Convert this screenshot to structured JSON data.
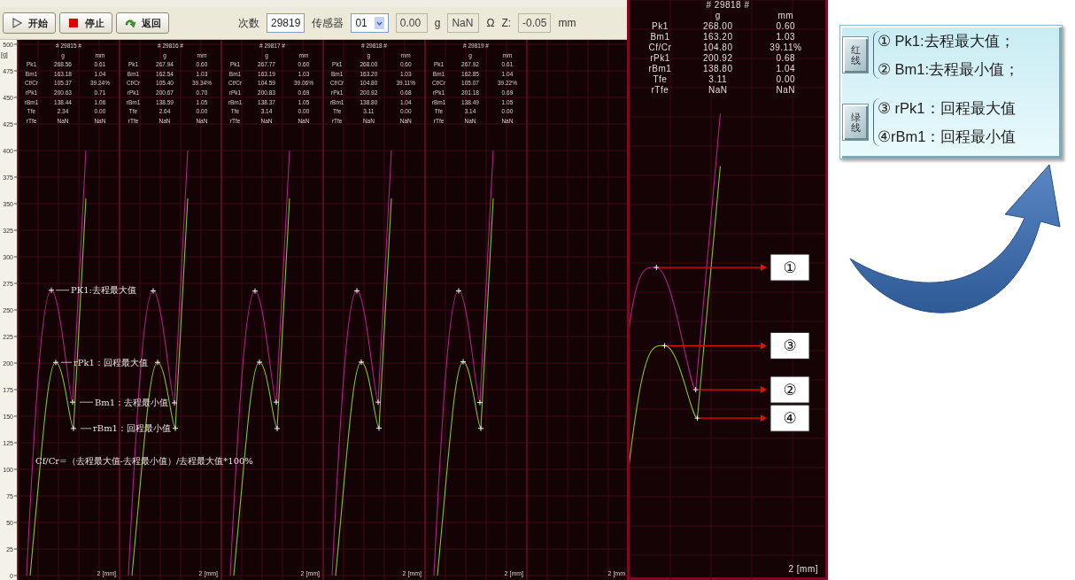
{
  "toolbar": {
    "buttons": [
      {
        "label": "开始",
        "kind": "start"
      },
      {
        "label": "停止",
        "kind": "stop"
      },
      {
        "label": "返回",
        "kind": "return"
      }
    ],
    "fields": [
      {
        "label": "次数",
        "value": "29819",
        "kind": "input",
        "disabled": false
      },
      {
        "label": "传感器",
        "value": "01",
        "kind": "select",
        "disabled": false
      },
      {
        "value": "0.00",
        "unit": "g",
        "kind": "input",
        "disabled": true
      },
      {
        "value": "NaN",
        "unit": "Ω",
        "kind": "input",
        "disabled": true
      },
      {
        "label": "Z:",
        "value": "-0.05",
        "unit": "mm",
        "kind": "input",
        "disabled": true
      }
    ]
  },
  "y_axis": {
    "unit": "[g]",
    "ticks": [
      "500",
      "475",
      "450",
      "425",
      "400",
      "375",
      "350",
      "325",
      "300",
      "275",
      "250",
      "225",
      "200",
      "175",
      "150",
      "125",
      "100",
      "75",
      "50",
      "25",
      "0"
    ]
  },
  "panels": [
    {
      "title": "# 29815 #",
      "columns": [
        "",
        "g",
        "mm"
      ],
      "rows": [
        [
          "Pk1",
          "268.56",
          "0.61"
        ],
        [
          "Bm1",
          "163.18",
          "1.04"
        ],
        [
          "Cf/Cr",
          "105.37",
          "39.24%"
        ],
        [
          "rPk1",
          "200.63",
          "0.71"
        ],
        [
          "rBm1",
          "138.44",
          "1.06"
        ],
        [
          "Tfe",
          "2.34",
          "0.00"
        ],
        [
          "rTfe",
          "NaN",
          "NaN"
        ]
      ],
      "x_label": "2 [mm]"
    },
    {
      "title": "# 29816 #",
      "columns": [
        "",
        "g",
        "mm"
      ],
      "rows": [
        [
          "Pk1",
          "267.94",
          "0.60"
        ],
        [
          "Bm1",
          "162.54",
          "1.03"
        ],
        [
          "Cf/Cr",
          "105.40",
          "39.34%"
        ],
        [
          "rPk1",
          "200.67",
          "0.70"
        ],
        [
          "rBm1",
          "138.59",
          "1.05"
        ],
        [
          "Tfe",
          "2.64",
          "0.00"
        ],
        [
          "rTfe",
          "NaN",
          "NaN"
        ]
      ],
      "x_label": "2 [mm]"
    },
    {
      "title": "# 29817 #",
      "columns": [
        "",
        "g",
        "mm"
      ],
      "rows": [
        [
          "Pk1",
          "267.77",
          "0.60"
        ],
        [
          "Bm1",
          "163.19",
          "1.03"
        ],
        [
          "Cf/Cr",
          "104.59",
          "39.06%"
        ],
        [
          "rPk1",
          "200.83",
          "0.69"
        ],
        [
          "rBm1",
          "138.37",
          "1.05"
        ],
        [
          "Tfe",
          "3.14",
          "0.00"
        ],
        [
          "rTfe",
          "NaN",
          "NaN"
        ]
      ],
      "x_label": "2 [mm]"
    },
    {
      "title": "# 29818 #",
      "columns": [
        "",
        "g",
        "mm"
      ],
      "rows": [
        [
          "Pk1",
          "268.00",
          "0.60"
        ],
        [
          "Bm1",
          "163.20",
          "1.03"
        ],
        [
          "Cf/Cr",
          "104.80",
          "39.11%"
        ],
        [
          "rPk1",
          "200.92",
          "0.68"
        ],
        [
          "rBm1",
          "138.80",
          "1.04"
        ],
        [
          "Tfe",
          "3.11",
          "0.00"
        ],
        [
          "rTfe",
          "NaN",
          "NaN"
        ]
      ],
      "x_label": "2 [mm]"
    },
    {
      "title": "# 29819 #",
      "columns": [
        "",
        "g",
        "mm"
      ],
      "rows": [
        [
          "Pk1",
          "267.92",
          "0.61"
        ],
        [
          "Bm1",
          "162.85",
          "1.04"
        ],
        [
          "Cf/Cr",
          "105.07",
          "39.22%"
        ],
        [
          "rPk1",
          "201.18",
          "0.69"
        ],
        [
          "rBm1",
          "138.49",
          "1.05"
        ],
        [
          "Tfe",
          "3.14",
          "0.00"
        ],
        [
          "rTfe",
          "NaN",
          "NaN"
        ]
      ],
      "x_label": "2 [mm]"
    },
    {
      "x_label": "2 [mm"
    }
  ],
  "chart_notes": [
    {
      "text": "PK1:去程最大值",
      "kind": "pk"
    },
    {
      "text": "rPk1：回程最大值",
      "kind": "rpk"
    },
    {
      "text": "Bm1：去程最小值",
      "kind": "bm"
    },
    {
      "text": "rBm1：回程最小值",
      "kind": "rbm"
    }
  ],
  "formula": "Cf/Cr=（去程最大值-去程最小值）/去程最大值*100%",
  "zoom_panel": {
    "title": "# 29818 #",
    "columns": [
      "",
      "g",
      "mm"
    ],
    "rows": [
      [
        "Pk1",
        "268.00",
        "0.60"
      ],
      [
        "Bm1",
        "163.20",
        "1.03"
      ],
      [
        "Cf/Cr",
        "104.80",
        "39.11%"
      ],
      [
        "rPk1",
        "200.92",
        "0.68"
      ],
      [
        "rBm1",
        "138.80",
        "1.04"
      ],
      [
        "Tfe",
        "3.11",
        "0.00"
      ],
      [
        "rTfe",
        "NaN",
        "NaN"
      ]
    ],
    "x_label": "2 [mm]",
    "callouts": [
      {
        "label": "①",
        "kind": "pk"
      },
      {
        "label": "③",
        "kind": "rpk"
      },
      {
        "label": "②",
        "kind": "bm"
      },
      {
        "label": "④",
        "kind": "rbm"
      }
    ]
  },
  "legend": {
    "groups": [
      {
        "tag": "红线",
        "items": [
          "① Pk1:去程最大值；",
          "② Bm1:去程最小值；"
        ]
      },
      {
        "tag": "绿线",
        "items": [
          "③ rPk1：回程最大值",
          "④rBm1：回程最小值"
        ]
      }
    ]
  }
}
